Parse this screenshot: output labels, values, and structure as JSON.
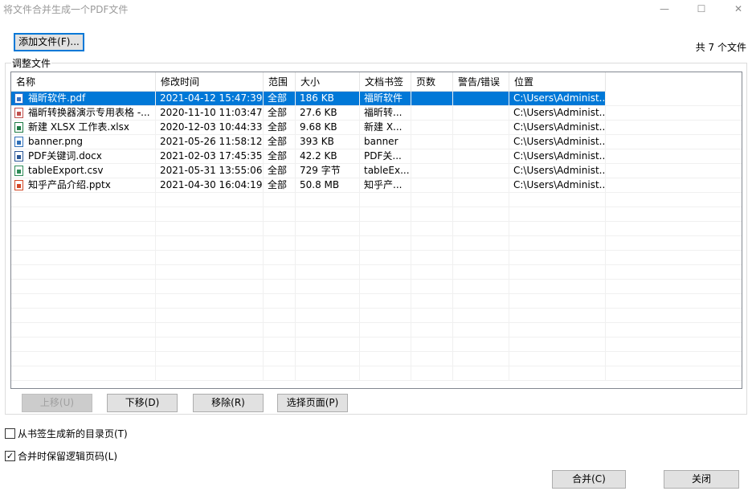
{
  "window": {
    "title": "将文件合并生成一个PDF文件",
    "minimize_glyph": "—",
    "maximize_glyph": "☐",
    "close_glyph": "✕"
  },
  "toolbar": {
    "add_files_label": "添加文件(F)...",
    "file_count": "共 7 个文件"
  },
  "group": {
    "title": "调整文件"
  },
  "table": {
    "columns": [
      "名称",
      "修改时间",
      "范围",
      "大小",
      "文档书签",
      "页数",
      "警告/错误",
      "位置"
    ],
    "rows": [
      {
        "icon": "pdf-file-icon",
        "name": "福昕软件.pdf",
        "modified": "2021-04-12 15:47:39",
        "range": "全部",
        "size": "186 KB",
        "bookmark": "福昕软件",
        "pages": "",
        "warning": "",
        "location": "C:\\Users\\Administ...",
        "selected": true
      },
      {
        "icon": "doc-file-icon",
        "name": "福昕转换器演示专用表格 -...",
        "modified": "2020-11-10 11:03:47",
        "range": "全部",
        "size": "27.6 KB",
        "bookmark": "福昕转...",
        "pages": "",
        "warning": "",
        "location": "C:\\Users\\Administ...",
        "selected": false
      },
      {
        "icon": "xlsx-file-icon",
        "name": "新建 XLSX 工作表.xlsx",
        "modified": "2020-12-03 10:44:33",
        "range": "全部",
        "size": "9.68 KB",
        "bookmark": "新建 X...",
        "pages": "",
        "warning": "",
        "location": "C:\\Users\\Administ...",
        "selected": false
      },
      {
        "icon": "png-file-icon",
        "name": "banner.png",
        "modified": "2021-05-26 11:58:12",
        "range": "全部",
        "size": "393 KB",
        "bookmark": "banner",
        "pages": "",
        "warning": "",
        "location": "C:\\Users\\Administ...",
        "selected": false
      },
      {
        "icon": "docx-file-icon",
        "name": "PDF关键词.docx",
        "modified": "2021-02-03 17:45:35",
        "range": "全部",
        "size": "42.2 KB",
        "bookmark": "PDF关...",
        "pages": "",
        "warning": "",
        "location": "C:\\Users\\Administ...",
        "selected": false
      },
      {
        "icon": "csv-file-icon",
        "name": "tableExport.csv",
        "modified": "2021-05-31 13:55:06",
        "range": "全部",
        "size": "729 字节",
        "bookmark": "tableEx...",
        "pages": "",
        "warning": "",
        "location": "C:\\Users\\Administ...",
        "selected": false
      },
      {
        "icon": "pptx-file-icon",
        "name": "知乎产品介绍.pptx",
        "modified": "2021-04-30 16:04:19",
        "range": "全部",
        "size": "50.8 MB",
        "bookmark": "知乎产...",
        "pages": "",
        "warning": "",
        "location": "C:\\Users\\Administ...",
        "selected": false
      }
    ]
  },
  "actions": {
    "move_up": "上移(U)",
    "move_down": "下移(D)",
    "remove": "移除(R)",
    "select_pages": "选择页面(P)"
  },
  "options": {
    "generate_toc_label": "从书签生成新的目录页(T)",
    "generate_toc_checked": false,
    "keep_logical_pages_label": "合并时保留逻辑页码(L)",
    "keep_logical_pages_checked": true,
    "check_glyph": "✓"
  },
  "footer": {
    "merge_label": "合并(C)",
    "close_label": "关闭"
  },
  "colors": {
    "selection": "#0078d7",
    "button_face": "#e1e1e1",
    "border": "#adadad"
  }
}
